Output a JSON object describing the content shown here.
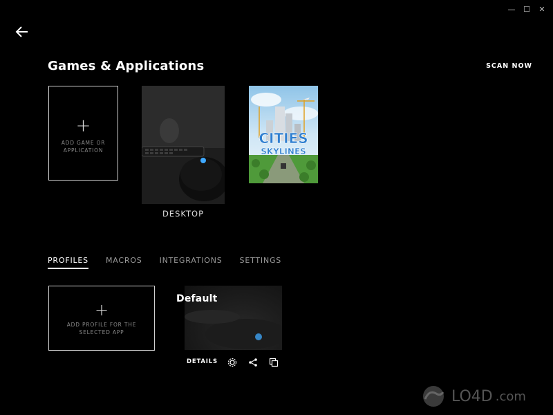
{
  "window": {
    "minimize_glyph": "—",
    "maximize_glyph": "☐",
    "close_glyph": "✕"
  },
  "header": {
    "title": "Games & Applications",
    "scan_label": "SCAN NOW"
  },
  "games": {
    "add_label": "ADD GAME OR APPLICATION",
    "add_glyph": "+",
    "items": [
      {
        "caption": "DESKTOP"
      },
      {
        "caption": "",
        "art_text_1": "CITIES",
        "art_text_2": "SKYLINES"
      }
    ]
  },
  "tabs": [
    {
      "label": "PROFILES",
      "active": true
    },
    {
      "label": "MACROS"
    },
    {
      "label": "INTEGRATIONS"
    },
    {
      "label": "SETTINGS"
    }
  ],
  "profiles": {
    "add_label": "ADD PROFILE FOR THE SELECTED APP",
    "add_glyph": "+",
    "items": [
      {
        "name": "Default",
        "details_label": "DETAILS"
      }
    ]
  },
  "watermark": {
    "brand": "LO4D",
    "suffix": ".com"
  },
  "colors": {
    "background": "#000000",
    "accent_blue": "#3fa9ff",
    "text": "#ffffff"
  }
}
